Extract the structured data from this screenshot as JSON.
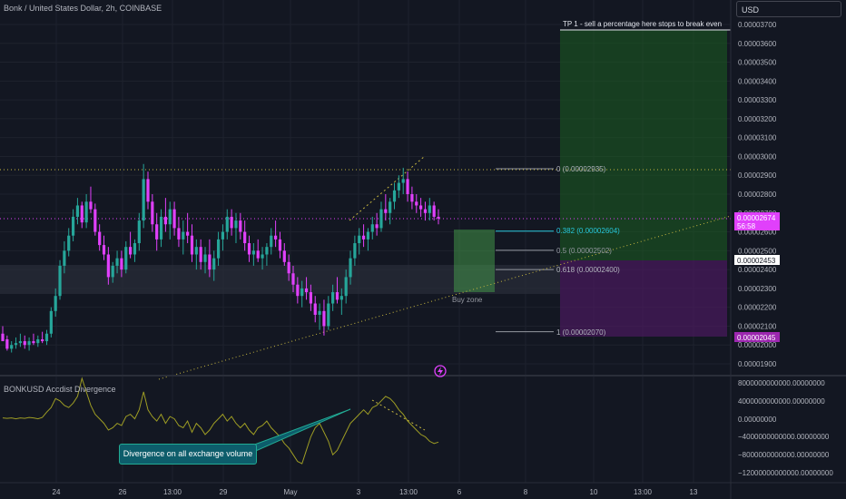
{
  "header": {
    "title": "Bonk / United States Dollar, 2h, COINBASE",
    "currency_button": "USD"
  },
  "indicator": {
    "title": "BONKUSD Accdist Divergence"
  },
  "annotations": {
    "tp_label": "TP 1 - sell a percentage here stops to break even",
    "buy_zone_label": "Buy zone",
    "divergence_callout": "Divergence on all exchange volume"
  },
  "fib_levels": [
    {
      "label": "0 (0.00002935)",
      "price": 2.935e-05
    },
    {
      "label": "0.382 (0.00002604)",
      "price": 2.604e-05
    },
    {
      "label": "0.5 (0.00002502)",
      "price": 2.502e-05
    },
    {
      "label": "0.618 (0.00002400)",
      "price": 2.4e-05
    },
    {
      "label": "1 (0.00002070)",
      "price": 2.07e-05
    }
  ],
  "price_badges": {
    "last_price": "0.00002674",
    "countdown": "56:58",
    "upper_marker": "0.00002453",
    "lower_marker": "0.00002045"
  },
  "colors": {
    "up": "#26a69a",
    "down": "#e040fb",
    "profit_zone": "#1b5e20",
    "loss_zone": "#4a1a5e",
    "fib_0382": "#26c6da",
    "oscillator_line": "#9e9d24",
    "dotted_trend": "#c8b840"
  },
  "chart_data": {
    "type": "candlestick",
    "price_axis": {
      "ticks": [
        "0.00003700",
        "0.00003600",
        "0.00003500",
        "0.00003400",
        "0.00003300",
        "0.00003200",
        "0.00003100",
        "0.00003000",
        "0.00002900",
        "0.00002800",
        "0.00002700",
        "0.00002600",
        "0.00002500",
        "0.00002400",
        "0.00002300",
        "0.00002200",
        "0.00002100",
        "0.00002000",
        "0.00001900"
      ],
      "range": [
        1.85e-05,
        3.73e-05
      ]
    },
    "time_axis": {
      "ticks": [
        "24",
        "26",
        "13:00",
        "29",
        "May",
        "3",
        "13:00",
        "6",
        "8",
        "10",
        "13:00",
        "13"
      ]
    },
    "oscillator_axis": {
      "ticks": [
        "8000000000000.00000000",
        "4000000000000.00000000",
        "0.00000000",
        "−4000000000000.00000000",
        "−8000000000000.00000000",
        "−12000000000000.00000000"
      ],
      "range": [
        -13000000000000,
        9000000000000
      ]
    },
    "candles": [
      [
        2.06,
        2.1,
        2.03,
        2.02
      ],
      [
        2.03,
        2.05,
        1.97,
        1.98
      ],
      [
        1.98,
        2.02,
        1.96,
        2.0
      ],
      [
        2.0,
        2.04,
        1.98,
        2.01
      ],
      [
        2.01,
        2.06,
        1.99,
        2.02
      ],
      [
        2.02,
        2.05,
        1.98,
        2.0
      ],
      [
        2.0,
        2.04,
        1.97,
        2.02
      ],
      [
        2.02,
        2.06,
        2.0,
        2.01
      ],
      [
        2.01,
        2.05,
        1.99,
        2.03
      ],
      [
        2.03,
        2.07,
        2.01,
        2.02
      ],
      [
        2.02,
        2.08,
        2.0,
        2.06
      ],
      [
        2.06,
        2.2,
        2.04,
        2.18
      ],
      [
        2.18,
        2.3,
        2.15,
        2.26
      ],
      [
        2.26,
        2.45,
        2.24,
        2.42
      ],
      [
        2.42,
        2.55,
        2.38,
        2.5
      ],
      [
        2.5,
        2.62,
        2.47,
        2.58
      ],
      [
        2.58,
        2.72,
        2.55,
        2.68
      ],
      [
        2.68,
        2.78,
        2.64,
        2.74
      ],
      [
        2.74,
        2.76,
        2.62,
        2.65
      ],
      [
        2.65,
        2.8,
        2.62,
        2.76
      ],
      [
        2.76,
        2.84,
        2.7,
        2.72
      ],
      [
        2.72,
        2.75,
        2.58,
        2.6
      ],
      [
        2.6,
        2.64,
        2.5,
        2.53
      ],
      [
        2.53,
        2.58,
        2.45,
        2.48
      ],
      [
        2.48,
        2.52,
        2.32,
        2.36
      ],
      [
        2.36,
        2.44,
        2.33,
        2.42
      ],
      [
        2.42,
        2.5,
        2.38,
        2.46
      ],
      [
        2.46,
        2.5,
        2.36,
        2.4
      ],
      [
        2.4,
        2.55,
        2.38,
        2.52
      ],
      [
        2.52,
        2.6,
        2.46,
        2.48
      ],
      [
        2.48,
        2.56,
        2.44,
        2.54
      ],
      [
        2.54,
        2.7,
        2.5,
        2.66
      ],
      [
        2.66,
        2.96,
        2.62,
        2.88
      ],
      [
        2.88,
        2.92,
        2.72,
        2.76
      ],
      [
        2.76,
        2.8,
        2.6,
        2.64
      ],
      [
        2.64,
        2.7,
        2.5,
        2.56
      ],
      [
        2.56,
        2.72,
        2.52,
        2.68
      ],
      [
        2.68,
        2.78,
        2.6,
        2.64
      ],
      [
        2.64,
        2.76,
        2.56,
        2.72
      ],
      [
        2.72,
        2.76,
        2.58,
        2.62
      ],
      [
        2.62,
        2.68,
        2.52,
        2.56
      ],
      [
        2.56,
        2.66,
        2.48,
        2.6
      ],
      [
        2.6,
        2.7,
        2.54,
        2.58
      ],
      [
        2.58,
        2.64,
        2.44,
        2.48
      ],
      [
        2.48,
        2.56,
        2.4,
        2.52
      ],
      [
        2.52,
        2.56,
        2.4,
        2.44
      ],
      [
        2.44,
        2.52,
        2.38,
        2.48
      ],
      [
        2.48,
        2.56,
        2.36,
        2.4
      ],
      [
        2.4,
        2.5,
        2.34,
        2.46
      ],
      [
        2.46,
        2.6,
        2.42,
        2.56
      ],
      [
        2.56,
        2.64,
        2.5,
        2.6
      ],
      [
        2.6,
        2.72,
        2.56,
        2.68
      ],
      [
        2.68,
        2.72,
        2.58,
        2.62
      ],
      [
        2.62,
        2.7,
        2.54,
        2.66
      ],
      [
        2.66,
        2.7,
        2.56,
        2.6
      ],
      [
        2.6,
        2.66,
        2.5,
        2.54
      ],
      [
        2.54,
        2.58,
        2.44,
        2.48
      ],
      [
        2.48,
        2.54,
        2.42,
        2.5
      ],
      [
        2.5,
        2.56,
        2.44,
        2.46
      ],
      [
        2.46,
        2.52,
        2.4,
        2.48
      ],
      [
        2.48,
        2.54,
        2.42,
        2.52
      ],
      [
        2.52,
        2.62,
        2.48,
        2.58
      ],
      [
        2.58,
        2.66,
        2.52,
        2.56
      ],
      [
        2.56,
        2.6,
        2.46,
        2.5
      ],
      [
        2.5,
        2.54,
        2.42,
        2.44
      ],
      [
        2.44,
        2.48,
        2.34,
        2.38
      ],
      [
        2.38,
        2.42,
        2.28,
        2.32
      ],
      [
        2.32,
        2.36,
        2.22,
        2.26
      ],
      [
        2.26,
        2.34,
        2.2,
        2.3
      ],
      [
        2.3,
        2.36,
        2.24,
        2.28
      ],
      [
        2.28,
        2.32,
        2.18,
        2.22
      ],
      [
        2.22,
        2.26,
        2.12,
        2.16
      ],
      [
        2.16,
        2.22,
        2.08,
        2.18
      ],
      [
        2.18,
        2.24,
        2.05,
        2.1
      ],
      [
        2.1,
        2.26,
        2.08,
        2.22
      ],
      [
        2.22,
        2.32,
        2.18,
        2.28
      ],
      [
        2.28,
        2.36,
        2.22,
        2.24
      ],
      [
        2.24,
        2.3,
        2.16,
        2.26
      ],
      [
        2.26,
        2.4,
        2.22,
        2.36
      ],
      [
        2.36,
        2.5,
        2.32,
        2.46
      ],
      [
        2.46,
        2.58,
        2.42,
        2.54
      ],
      [
        2.54,
        2.62,
        2.48,
        2.58
      ],
      [
        2.58,
        2.64,
        2.52,
        2.56
      ],
      [
        2.56,
        2.62,
        2.5,
        2.6
      ],
      [
        2.6,
        2.68,
        2.56,
        2.64
      ],
      [
        2.64,
        2.7,
        2.58,
        2.62
      ],
      [
        2.62,
        2.76,
        2.6,
        2.72
      ],
      [
        2.72,
        2.8,
        2.66,
        2.7
      ],
      [
        2.7,
        2.78,
        2.64,
        2.76
      ],
      [
        2.76,
        2.86,
        2.72,
        2.82
      ],
      [
        2.82,
        2.9,
        2.78,
        2.86
      ],
      [
        2.86,
        2.94,
        2.8,
        2.88
      ],
      [
        2.88,
        2.92,
        2.76,
        2.8
      ],
      [
        2.8,
        2.84,
        2.72,
        2.76
      ],
      [
        2.76,
        2.8,
        2.7,
        2.74
      ],
      [
        2.74,
        2.78,
        2.68,
        2.72
      ],
      [
        2.72,
        2.76,
        2.66,
        2.7
      ],
      [
        2.7,
        2.78,
        2.66,
        2.74
      ],
      [
        2.74,
        2.76,
        2.66,
        2.68
      ],
      [
        2.68,
        2.72,
        2.64,
        2.67
      ]
    ],
    "candle_units": "prices x 0.00001",
    "oscillator": [
      0.2,
      0.1,
      0.2,
      0.0,
      0.2,
      0.1,
      0.3,
      0.2,
      0.0,
      0.3,
      1.5,
      2.5,
      4.5,
      4.0,
      3.0,
      2.5,
      3.5,
      5.0,
      9.0,
      6.0,
      3.0,
      1.0,
      0.0,
      -1.0,
      -2.5,
      -2.0,
      -1.0,
      -1.5,
      0.5,
      1.0,
      0.0,
      2.0,
      6.0,
      2.0,
      0.5,
      -0.5,
      1.0,
      -1.0,
      0.5,
      0.0,
      -1.5,
      -2.0,
      -0.5,
      -3.0,
      -1.0,
      -2.0,
      -3.5,
      -2.5,
      -1.0,
      0.0,
      1.0,
      -0.5,
      0.5,
      -1.0,
      -2.0,
      -1.0,
      -2.5,
      -3.5,
      -2.0,
      -1.5,
      -0.5,
      -2.0,
      -3.0,
      -4.0,
      -5.5,
      -6.5,
      -8.0,
      -9.5,
      -10.0,
      -7.0,
      -4.0,
      -2.0,
      -1.0,
      -3.0,
      -5.0,
      -8.0,
      -7.0,
      -5.0,
      -3.0,
      -1.0,
      0.0,
      1.0,
      2.0,
      1.0,
      2.5,
      3.0,
      4.0,
      5.0,
      4.5,
      3.5,
      2.0,
      1.0,
      -0.5,
      -1.5,
      -2.5,
      -3.5,
      -4.0,
      -5.0,
      -5.5,
      -5.2
    ],
    "oscillator_units": "x 1e12"
  }
}
